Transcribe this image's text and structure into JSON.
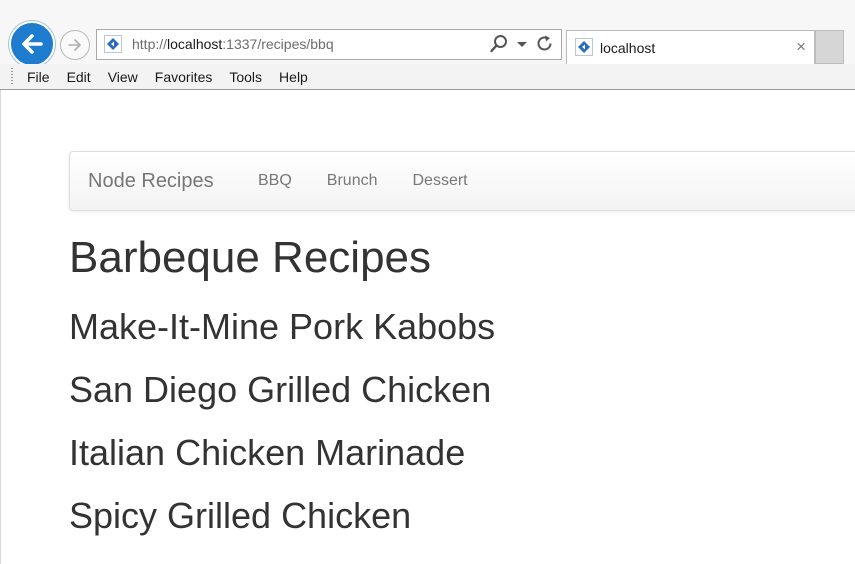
{
  "browser": {
    "url_prefix": "http://",
    "url_host": "localhost",
    "url_path": ":1337/recipes/bbq",
    "tab_title": "localhost",
    "tab_close": "×",
    "menu": [
      "File",
      "Edit",
      "View",
      "Favorites",
      "Tools",
      "Help"
    ]
  },
  "navbar": {
    "brand": "Node Recipes",
    "links": [
      "BBQ",
      "Brunch",
      "Dessert"
    ]
  },
  "page": {
    "title": "Barbeque Recipes",
    "recipes": [
      "Make-It-Mine Pork Kabobs",
      "San Diego Grilled Chicken",
      "Italian Chicken Marinade",
      "Spicy Grilled Chicken"
    ]
  },
  "colors": {
    "back_button": "#1e7ccf",
    "text": "#333333",
    "nav_text": "#777777"
  },
  "icons": [
    "back-arrow-icon",
    "forward-arrow-icon",
    "site-favicon-icon",
    "search-icon",
    "dropdown-icon",
    "refresh-icon",
    "close-icon"
  ]
}
